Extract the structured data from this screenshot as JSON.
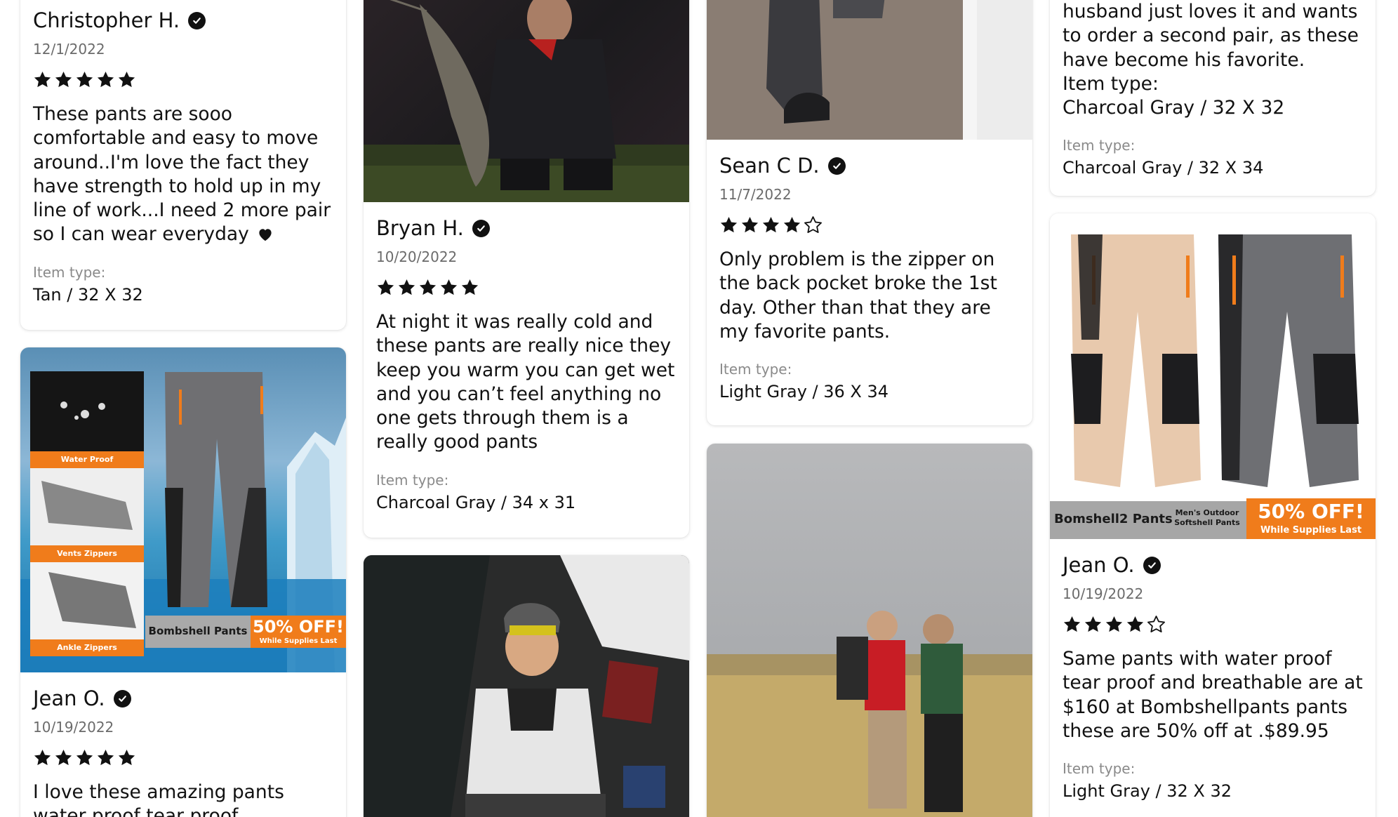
{
  "reviews": {
    "christopher": {
      "name": "Christopher H.",
      "date": "12/1/2022",
      "rating": 5,
      "text": "These pants are sooo comfortable and easy to move around..I'm love the fact they have strength to hold up in my line of work...I need 2 more pair so I can wear everyday",
      "item_label": "Item type:",
      "item_value": "Tan / 32 X 32"
    },
    "jean_col1": {
      "name": "Jean O.",
      "date": "10/19/2022",
      "rating": 5,
      "text": "I love these amazing pants water proof tear proof",
      "image": {
        "labels": [
          "Water Proof",
          "Vents Zippers",
          "Ankle Zippers"
        ],
        "brand": "Bombshell Pants",
        "discount": "50% OFF!",
        "discount_sub": "While Supplies Last"
      }
    },
    "bryan": {
      "name": "Bryan H.",
      "date": "10/20/2022",
      "rating": 5,
      "text": "At night it was really cold and these pants are really nice they keep you warm you can get wet and you can’t feel anything no one gets through them is a really good pants",
      "item_label": "Item type:",
      "item_value": "Charcoal Gray / 34 x 31"
    },
    "sean": {
      "name": "Sean C D.",
      "date": "11/7/2022",
      "rating": 4,
      "text": "Only problem is the zipper on the back pocket broke the 1st day. Other than that they are my favorite pants.",
      "item_label": "Item type:",
      "item_value": "Light Gray / 36 X 34"
    },
    "top_right": {
      "text": "husband just loves it and wants to order a second pair, as these have become his favorite.\nItem type:\nCharcoal Gray / 32 X 32",
      "item_label": "Item type:",
      "item_value": "Charcoal Gray / 32 X 34"
    },
    "jean_col4": {
      "name": "Jean O.",
      "date": "10/19/2022",
      "rating": 4,
      "text": "Same pants with water proof tear proof and breathable are at $160 at Bombshellpants pants these are 50% off at .$89.95",
      "item_label": "Item type:",
      "item_value": "Light Gray / 32 X 32",
      "image": {
        "brand": "Bomshell2 Pants",
        "subtitle": "Men's Outdoor Softshell Pants",
        "discount": "50% OFF!",
        "discount_sub": "While Supplies Last"
      }
    }
  },
  "colors": {
    "text": "#111111",
    "muted": "#6b6b6b",
    "label": "#8a8a8a",
    "orange": "#f07c1b"
  },
  "icons": [
    "verified-check-icon",
    "star-filled-icon",
    "star-outline-icon",
    "heart-icon"
  ]
}
